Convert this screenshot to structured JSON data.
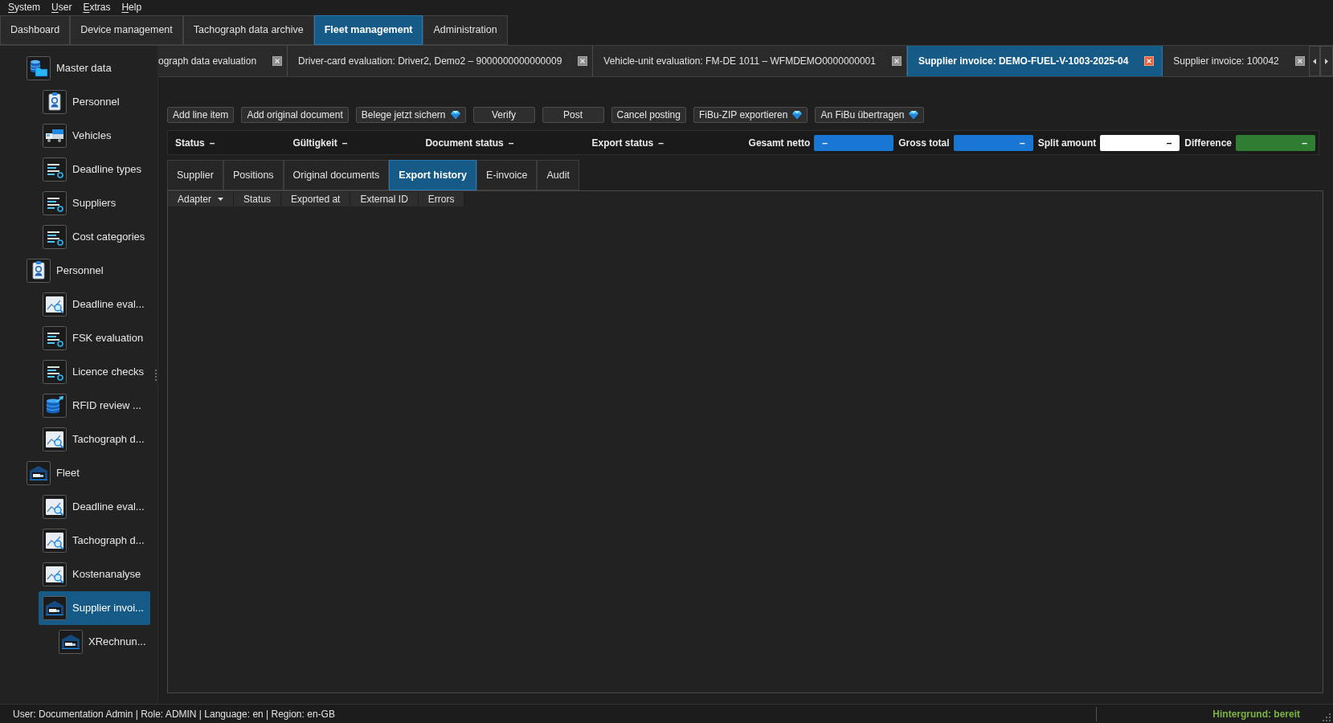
{
  "menu": [
    "System",
    "User",
    "Extras",
    "Help"
  ],
  "main_tabs": [
    {
      "label": "Dashboard",
      "selected": false
    },
    {
      "label": "Device management",
      "selected": false
    },
    {
      "label": "Tachograph data archive",
      "selected": false
    },
    {
      "label": "Fleet management",
      "selected": true
    },
    {
      "label": "Administration",
      "selected": false
    }
  ],
  "sidebar": {
    "items": [
      {
        "label": "Master data",
        "kind": "data",
        "selected": false,
        "children": [
          {
            "label": "Personnel",
            "kind": "person",
            "selected": false
          },
          {
            "label": "Vehicles",
            "kind": "vehicle",
            "selected": false
          },
          {
            "label": "Deadline types",
            "kind": "list",
            "selected": false
          },
          {
            "label": "Suppliers",
            "kind": "list",
            "selected": false
          },
          {
            "label": "Cost categories",
            "kind": "list",
            "selected": false
          }
        ]
      },
      {
        "label": "Personnel",
        "kind": "person",
        "selected": false,
        "children": [
          {
            "label": "Deadline eval...",
            "kind": "chart",
            "selected": false
          },
          {
            "label": "FSK evaluation",
            "kind": "list",
            "selected": false
          },
          {
            "label": "Licence checks",
            "kind": "list",
            "selected": false
          },
          {
            "label": "RFID review ...",
            "kind": "import",
            "selected": false
          },
          {
            "label": "Tachograph d...",
            "kind": "chart",
            "selected": false
          }
        ]
      },
      {
        "label": "Fleet",
        "kind": "fleet",
        "selected": false,
        "children": [
          {
            "label": "Deadline eval...",
            "kind": "chart",
            "selected": false
          },
          {
            "label": "Tachograph d...",
            "kind": "chart",
            "selected": false
          },
          {
            "label": "Kostenanalyse",
            "kind": "chart",
            "selected": false
          },
          {
            "label": "Supplier invoi...",
            "kind": "fleet",
            "selected": true,
            "children": [
              {
                "label": "XRechnun...",
                "kind": "fleet",
                "selected": false
              }
            ]
          }
        ]
      }
    ]
  },
  "document_tabs": [
    {
      "label": "ograph data evaluation",
      "selected": false
    },
    {
      "label": "Driver-card evaluation: Driver2, Demo2 – 9000000000000009",
      "selected": false
    },
    {
      "label": "Vehicle-unit evaluation: FM-DE 1011 – WFMDEMO0000000001",
      "selected": false
    },
    {
      "label": "Supplier invoice: DEMO-FUEL-V-1003-2025-04",
      "selected": true
    },
    {
      "label": "Supplier invoice: 100042",
      "selected": false
    }
  ],
  "toolbar": [
    {
      "label": "Add line item",
      "premium": false
    },
    {
      "label": "Add original document",
      "premium": false
    },
    {
      "label": "Belege jetzt sichern",
      "premium": true
    },
    {
      "label": "Verify",
      "premium": false
    },
    {
      "label": "Post",
      "premium": false
    },
    {
      "label": "Cancel posting",
      "premium": false
    },
    {
      "label": "FiBu-ZIP exportieren",
      "premium": true
    },
    {
      "label": "An FiBu übertragen",
      "premium": true
    }
  ],
  "summary": {
    "statuses": [
      {
        "label": "Status",
        "value": "–"
      },
      {
        "label": "Gültigkeit",
        "value": "–"
      },
      {
        "label": "Document status",
        "value": "–"
      },
      {
        "label": "Export status",
        "value": "–"
      }
    ],
    "amounts": [
      {
        "label": "Gesamt netto",
        "value": "–",
        "color": "#1976d2",
        "left_aligned": true
      },
      {
        "label": "Gross total",
        "value": "–",
        "color": "#1976d2",
        "left_aligned": false
      },
      {
        "label": "Split amount",
        "value": "–",
        "color": "#ffffff",
        "left_aligned": false
      },
      {
        "label": "Difference",
        "value": "–",
        "color": "#2e7d32",
        "left_aligned": false
      }
    ]
  },
  "detail_tabs": [
    {
      "label": "Supplier",
      "selected": false
    },
    {
      "label": "Positions",
      "selected": false
    },
    {
      "label": "Original documents",
      "selected": false
    },
    {
      "label": "Export history",
      "selected": true
    },
    {
      "label": "E-invoice",
      "selected": false
    },
    {
      "label": "Audit",
      "selected": false
    }
  ],
  "table": {
    "columns": [
      {
        "label": "Adapter",
        "dropdown": true
      },
      {
        "label": "Status",
        "dropdown": false
      },
      {
        "label": "Exported at",
        "dropdown": false
      },
      {
        "label": "External ID",
        "dropdown": false
      },
      {
        "label": "Errors",
        "dropdown": false
      }
    ]
  },
  "status_bar": {
    "session": "User: Documentation Admin | Role: ADMIN | Language: en | Region: en-GB",
    "background_task": "Hintergrund: bereit"
  }
}
